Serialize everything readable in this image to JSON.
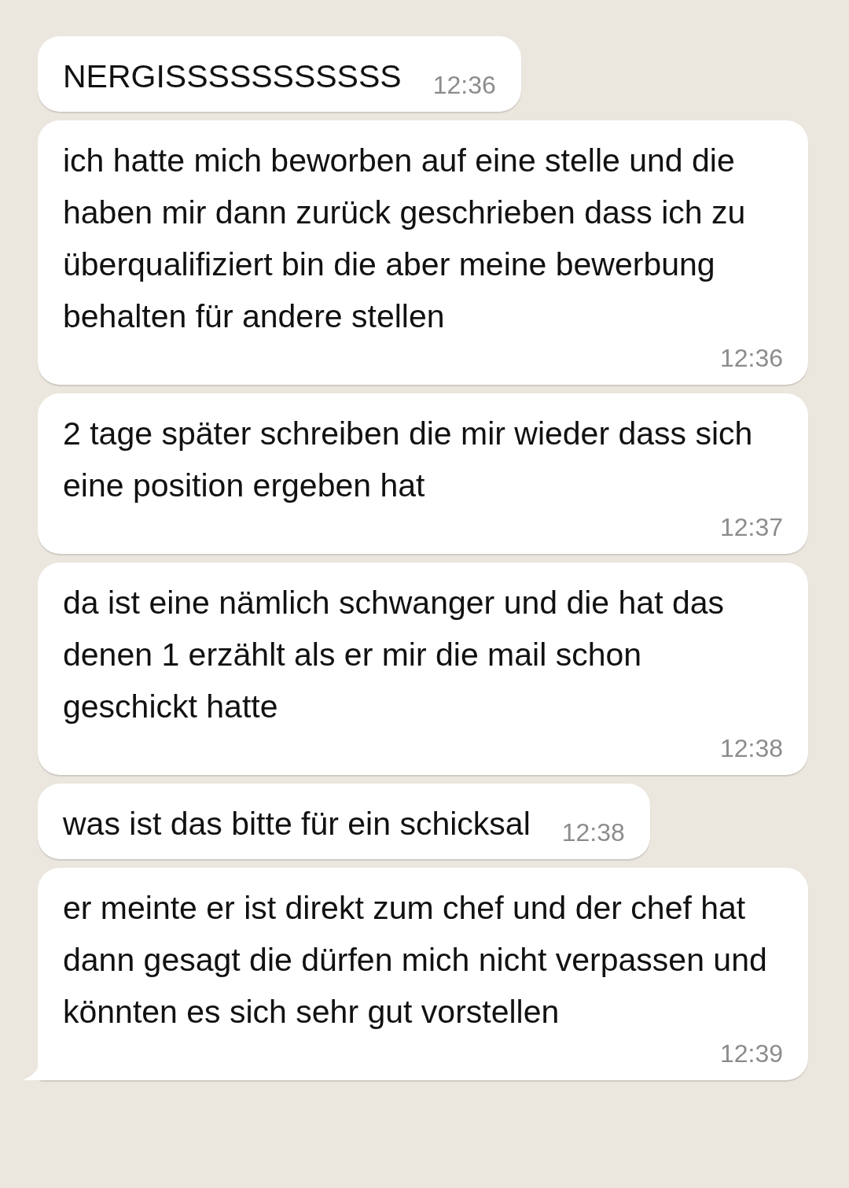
{
  "messages": [
    {
      "text": "NERGISSSSSSSSSSS",
      "time": "12:36",
      "tail": false
    },
    {
      "text": "ich hatte mich beworben auf eine stelle und die haben mir dann zurück geschrieben dass ich zu überqualifiziert bin die aber meine bewerbung behalten für andere stellen",
      "time": "12:36",
      "tail": false
    },
    {
      "text": "2 tage später schreiben die mir wieder dass sich eine position ergeben hat",
      "time": "12:37",
      "tail": false
    },
    {
      "text": "da ist eine nämlich schwanger und die hat das denen 1 erzählt als er mir die mail schon geschickt hatte",
      "time": "12:38",
      "tail": false
    },
    {
      "text": "was ist das bitte für ein schicksal",
      "time": "12:38",
      "tail": false
    },
    {
      "text": "er meinte er ist direkt zum chef und der chef hat dann gesagt die dürfen mich nicht verpassen und könnten es sich sehr gut vorstellen",
      "time": "12:39",
      "tail": true
    }
  ]
}
